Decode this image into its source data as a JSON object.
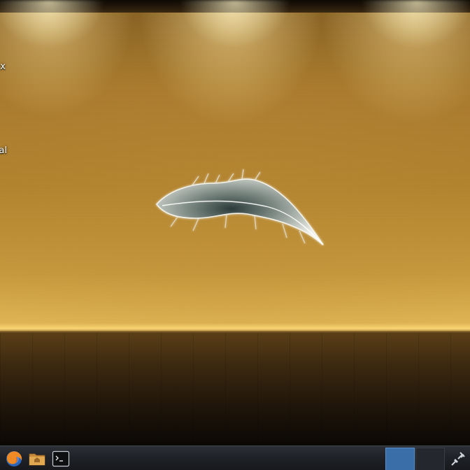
{
  "desktop": {
    "icons": [
      {
        "label": "x"
      },
      {
        "label": "al"
      }
    ]
  },
  "taskbar": {
    "launchers": [
      {
        "icon": "firefox-icon"
      },
      {
        "icon": "home-folder-icon"
      },
      {
        "icon": "terminal-icon"
      }
    ],
    "workspaces": [
      {
        "active": true
      },
      {
        "active": false
      }
    ],
    "tray": [
      {
        "icon": "network-plug-icon"
      }
    ]
  },
  "colors": {
    "wallpaper_accent": "#c69a3d",
    "workspace_active": "#3a6ea8",
    "taskbar_bg": "#1f2227"
  }
}
